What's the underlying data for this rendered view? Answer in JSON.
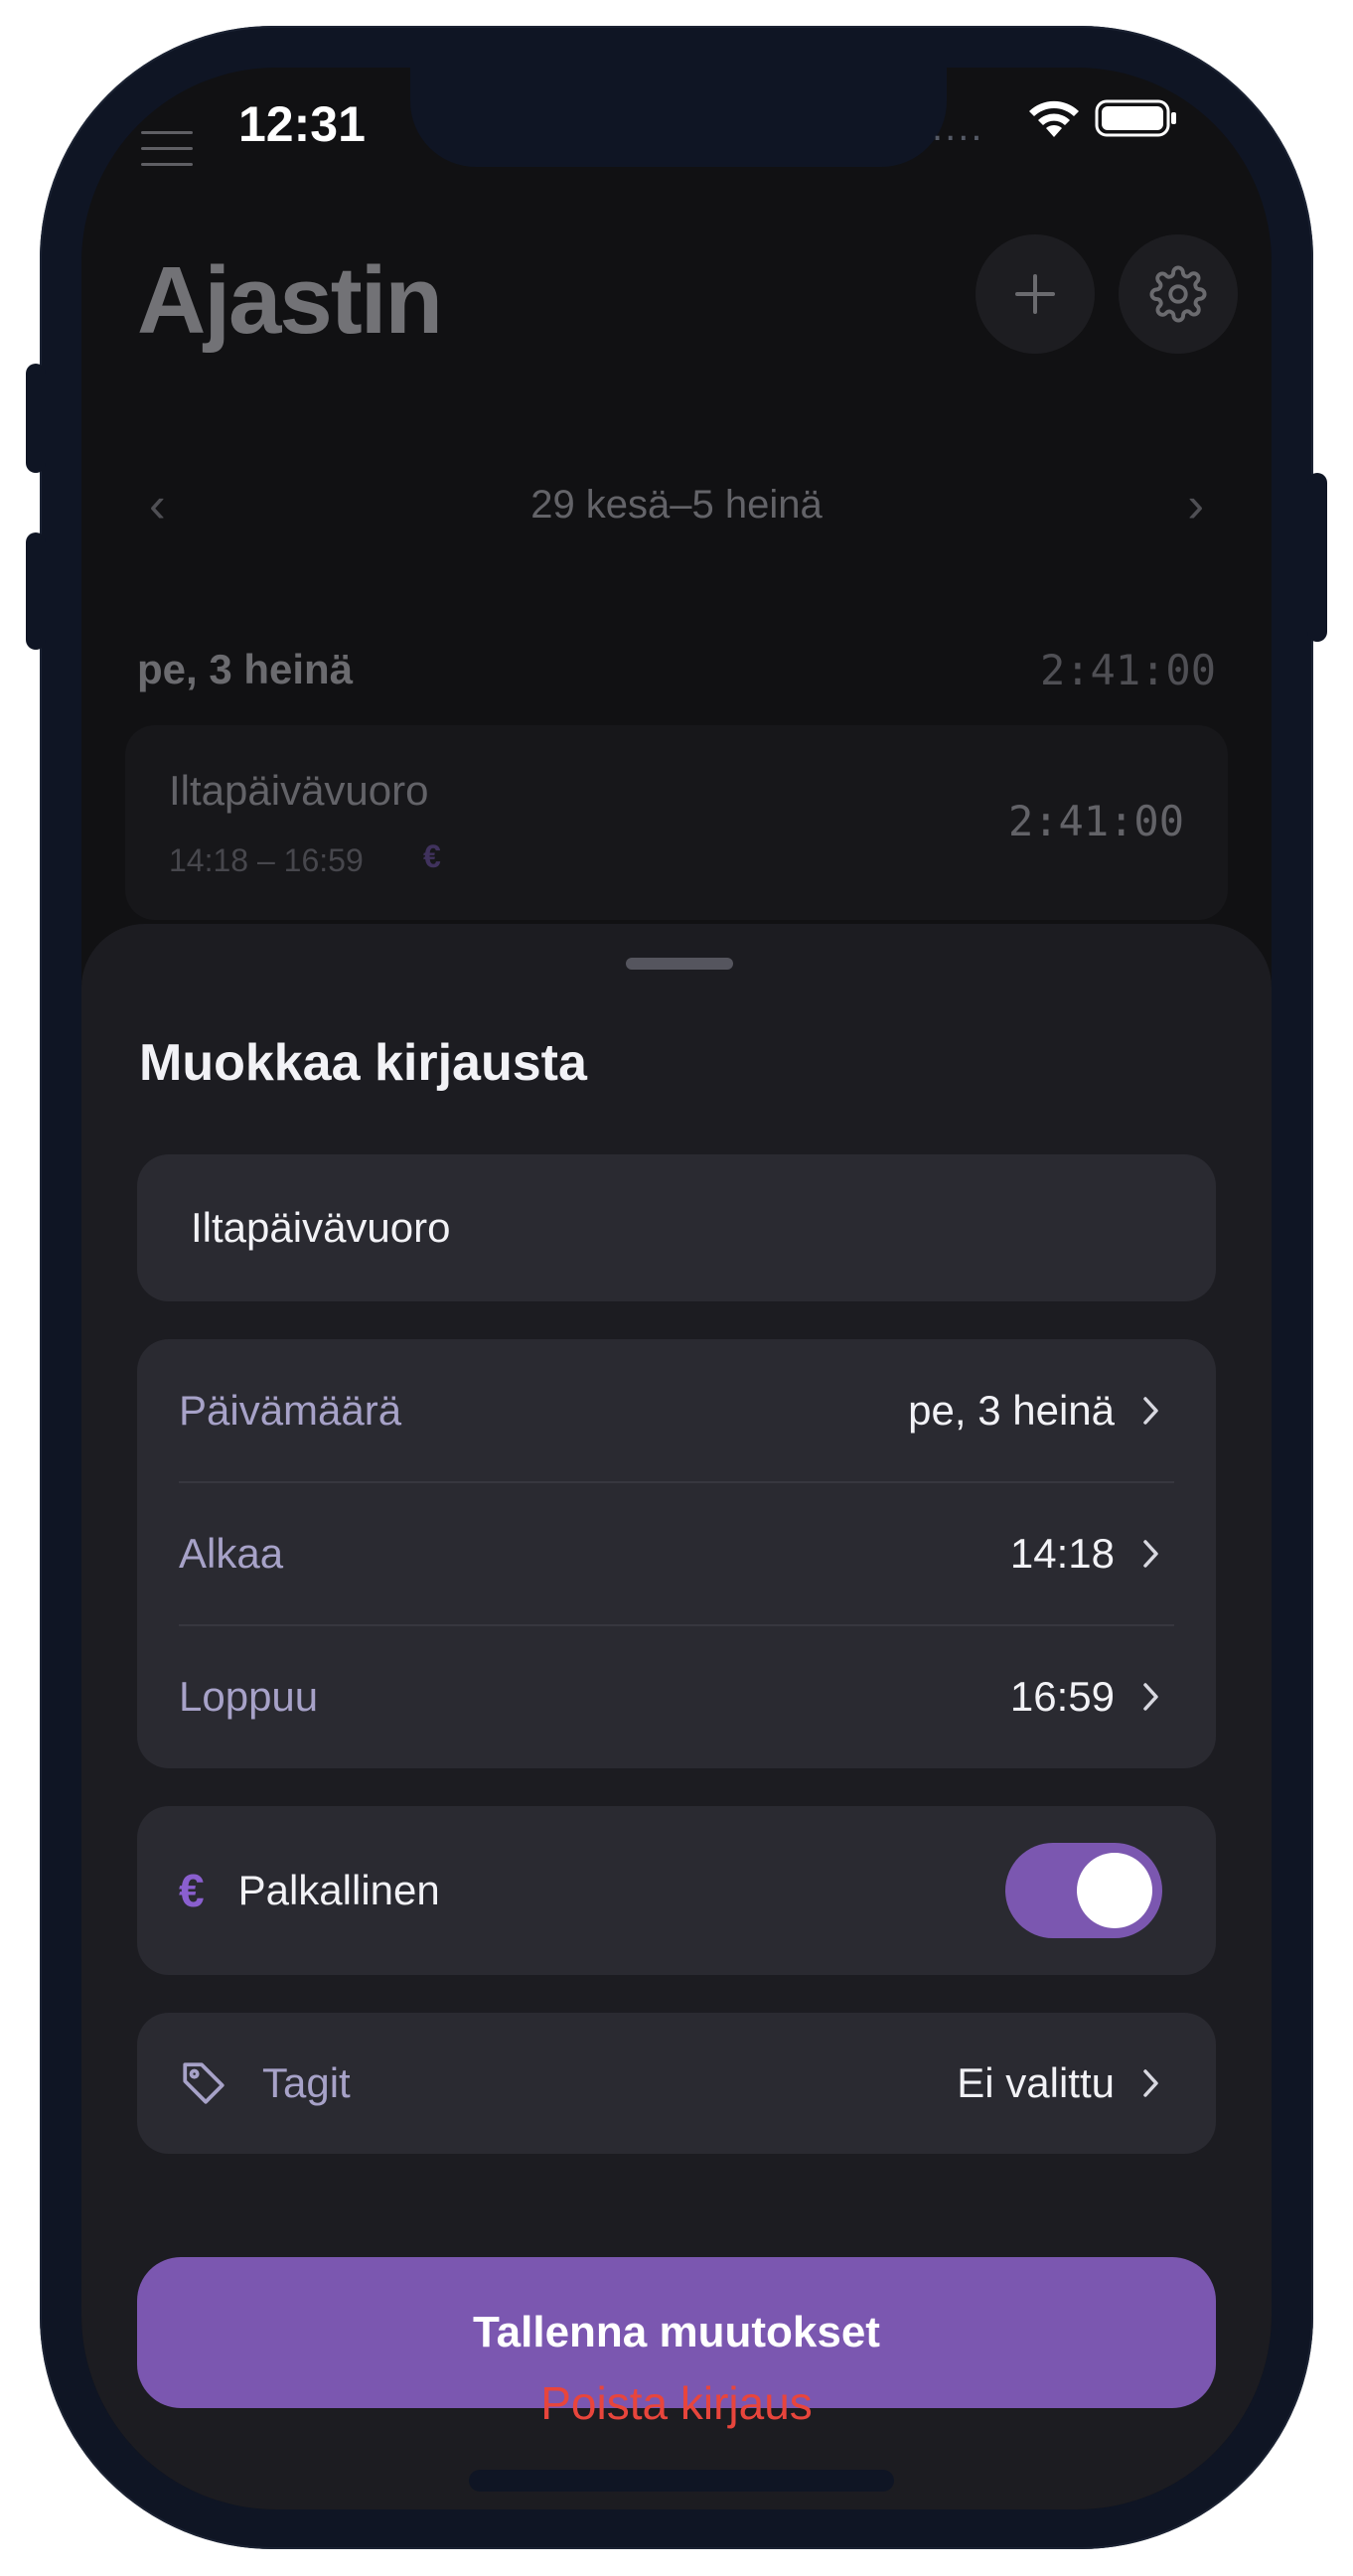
{
  "status_bar": {
    "time": "12:31",
    "signal_dots": "....",
    "wifi_icon": "wifi-icon",
    "battery_icon": "battery-icon"
  },
  "header": {
    "title": "Ajastin",
    "menu_icon": "hamburger-menu-icon",
    "add_icon": "plus-icon",
    "settings_icon": "gear-icon"
  },
  "week_nav": {
    "label": "29 kesä–5 heinä",
    "prev_icon": "chevron-left-icon",
    "next_icon": "chevron-right-icon"
  },
  "day": {
    "label": "pe, 3 heinä",
    "total": "2:41:00",
    "entry": {
      "name": "Iltapäivävuoro",
      "time_range": "14:18 – 16:59",
      "paid_symbol": "€",
      "duration": "2:41:00"
    }
  },
  "sheet": {
    "title": "Muokkaa kirjausta",
    "name_value": "Iltapäivävuoro",
    "date_label": "Päivämäärä",
    "date_value": "pe, 3 heinä",
    "start_label": "Alkaa",
    "start_value": "14:18",
    "end_label": "Loppuu",
    "end_value": "16:59",
    "paid_symbol": "€",
    "paid_label": "Palkallinen",
    "paid_on": true,
    "tags_label": "Tagit",
    "tags_value": "Ei valittu",
    "save_label": "Tallenna muutokset",
    "delete_label": "Poista kirjaus"
  },
  "colors": {
    "accent": "#7b57b0",
    "destructive": "#e8453c",
    "sheet_bg": "#1c1c21",
    "group_bg": "#2a2a31"
  }
}
